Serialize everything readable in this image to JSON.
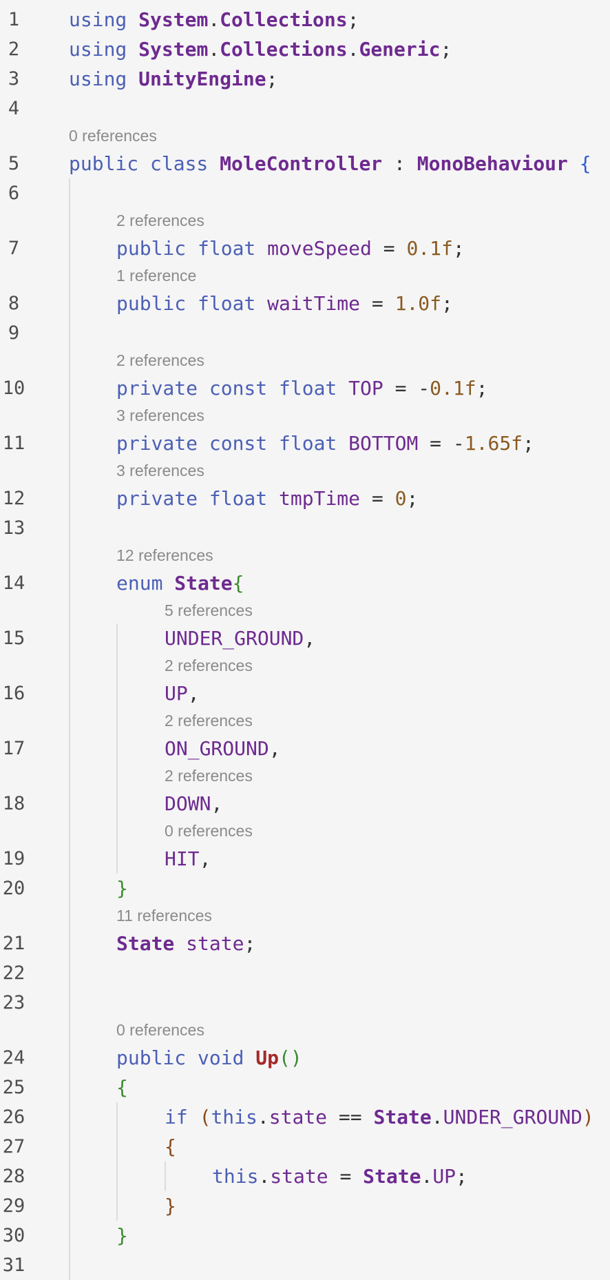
{
  "editor": {
    "lines": [
      {
        "n": "1",
        "indent": 0,
        "tokens": [
          [
            "kw",
            "using "
          ],
          [
            "type",
            "System"
          ],
          [
            "punct",
            "."
          ],
          [
            "type",
            "Collections"
          ],
          [
            "punct",
            ";"
          ]
        ]
      },
      {
        "n": "2",
        "indent": 0,
        "tokens": [
          [
            "kw",
            "using "
          ],
          [
            "type",
            "System"
          ],
          [
            "punct",
            "."
          ],
          [
            "type",
            "Collections"
          ],
          [
            "punct",
            "."
          ],
          [
            "type",
            "Generic"
          ],
          [
            "punct",
            ";"
          ]
        ]
      },
      {
        "n": "3",
        "indent": 0,
        "tokens": [
          [
            "kw",
            "using "
          ],
          [
            "type",
            "UnityEngine"
          ],
          [
            "punct",
            ";"
          ]
        ]
      },
      {
        "n": "4",
        "indent": 0,
        "tokens": []
      },
      {
        "n": "5",
        "indent": 0,
        "lens": "0 references",
        "tokens": [
          [
            "kw",
            "public class "
          ],
          [
            "type",
            "MoleController"
          ],
          [
            "punct",
            " : "
          ],
          [
            "type",
            "MonoBehaviour"
          ],
          [
            "brace1",
            " {"
          ]
        ]
      },
      {
        "n": "6",
        "indent": 0,
        "tokens": []
      },
      {
        "n": "7",
        "indent": 1,
        "lens": "2 references",
        "tokens": [
          [
            "kw",
            "public float "
          ],
          [
            "ident",
            "moveSpeed"
          ],
          [
            "punct",
            " = "
          ],
          [
            "num",
            "0.1f"
          ],
          [
            "punct",
            ";"
          ]
        ]
      },
      {
        "n": "8",
        "indent": 1,
        "lens": "1 reference",
        "tokens": [
          [
            "kw",
            "public float "
          ],
          [
            "ident",
            "waitTime"
          ],
          [
            "punct",
            " = "
          ],
          [
            "num",
            "1.0f"
          ],
          [
            "punct",
            ";"
          ]
        ]
      },
      {
        "n": "9",
        "indent": 0,
        "tokens": []
      },
      {
        "n": "10",
        "indent": 1,
        "lens": "2 references",
        "tokens": [
          [
            "kw",
            "private const float "
          ],
          [
            "ident",
            "TOP"
          ],
          [
            "punct",
            " = -"
          ],
          [
            "num",
            "0.1f"
          ],
          [
            "punct",
            ";"
          ]
        ]
      },
      {
        "n": "11",
        "indent": 1,
        "lens": "3 references",
        "tokens": [
          [
            "kw",
            "private const float "
          ],
          [
            "ident",
            "BOTTOM"
          ],
          [
            "punct",
            " = -"
          ],
          [
            "num",
            "1.65f"
          ],
          [
            "punct",
            ";"
          ]
        ]
      },
      {
        "n": "12",
        "indent": 1,
        "lens": "3 references",
        "tokens": [
          [
            "kw",
            "private float "
          ],
          [
            "ident",
            "tmpTime"
          ],
          [
            "punct",
            " = "
          ],
          [
            "num",
            "0"
          ],
          [
            "punct",
            ";"
          ]
        ]
      },
      {
        "n": "13",
        "indent": 0,
        "tokens": []
      },
      {
        "n": "14",
        "indent": 1,
        "lens": "12 references",
        "tokens": [
          [
            "kw",
            "enum "
          ],
          [
            "type",
            "State"
          ],
          [
            "brace2",
            "{"
          ]
        ]
      },
      {
        "n": "15",
        "indent": 2,
        "lens": "5 references",
        "tokens": [
          [
            "ident",
            "UNDER_GROUND"
          ],
          [
            "punct",
            ","
          ]
        ]
      },
      {
        "n": "16",
        "indent": 2,
        "lens": "2 references",
        "tokens": [
          [
            "ident",
            "UP"
          ],
          [
            "punct",
            ","
          ]
        ]
      },
      {
        "n": "17",
        "indent": 2,
        "lens": "2 references",
        "tokens": [
          [
            "ident",
            "ON_GROUND"
          ],
          [
            "punct",
            ","
          ]
        ]
      },
      {
        "n": "18",
        "indent": 2,
        "lens": "2 references",
        "tokens": [
          [
            "ident",
            "DOWN"
          ],
          [
            "punct",
            ","
          ]
        ]
      },
      {
        "n": "19",
        "indent": 2,
        "lens": "0 references",
        "tokens": [
          [
            "ident",
            "HIT"
          ],
          [
            "punct",
            ","
          ]
        ]
      },
      {
        "n": "20",
        "indent": 1,
        "tokens": [
          [
            "brace2",
            "}"
          ]
        ]
      },
      {
        "n": "21",
        "indent": 1,
        "lens": "11 references",
        "tokens": [
          [
            "type",
            "State"
          ],
          [
            "ident",
            " state"
          ],
          [
            "punct",
            ";"
          ]
        ]
      },
      {
        "n": "22",
        "indent": 0,
        "tokens": []
      },
      {
        "n": "23",
        "indent": 0,
        "tokens": []
      },
      {
        "n": "24",
        "indent": 1,
        "lens": "0 references",
        "tokens": [
          [
            "kw",
            "public void "
          ],
          [
            "method",
            "Up"
          ],
          [
            "brace2",
            "()"
          ]
        ]
      },
      {
        "n": "25",
        "indent": 1,
        "tokens": [
          [
            "brace2",
            "{"
          ]
        ]
      },
      {
        "n": "26",
        "indent": 2,
        "tokens": [
          [
            "kw",
            "if "
          ],
          [
            "brace3",
            "("
          ],
          [
            "kw",
            "this"
          ],
          [
            "punct",
            "."
          ],
          [
            "ident",
            "state"
          ],
          [
            "punct",
            " == "
          ],
          [
            "type",
            "State"
          ],
          [
            "punct",
            "."
          ],
          [
            "ident",
            "UNDER_GROUND"
          ],
          [
            "brace3",
            ")"
          ]
        ]
      },
      {
        "n": "27",
        "indent": 2,
        "tokens": [
          [
            "brace3",
            "{"
          ]
        ]
      },
      {
        "n": "28",
        "indent": 3,
        "tokens": [
          [
            "kw",
            "this"
          ],
          [
            "punct",
            "."
          ],
          [
            "ident",
            "state"
          ],
          [
            "punct",
            " = "
          ],
          [
            "type",
            "State"
          ],
          [
            "punct",
            "."
          ],
          [
            "ident",
            "UP"
          ],
          [
            "punct",
            ";"
          ]
        ]
      },
      {
        "n": "29",
        "indent": 2,
        "tokens": [
          [
            "brace3",
            "}"
          ]
        ]
      },
      {
        "n": "30",
        "indent": 1,
        "tokens": [
          [
            "brace2",
            "}"
          ]
        ]
      },
      {
        "n": "31",
        "indent": 0,
        "tokens": []
      }
    ]
  }
}
